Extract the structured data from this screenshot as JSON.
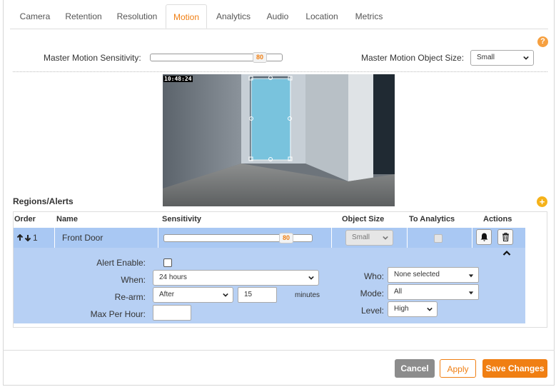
{
  "tabs": [
    "Camera",
    "Retention",
    "Resolution",
    "Motion",
    "Analytics",
    "Audio",
    "Location",
    "Metrics"
  ],
  "active_tab": "Motion",
  "help_icon": "?",
  "master": {
    "sensitivity_label": "Master Motion Sensitivity:",
    "sensitivity_value": "80",
    "object_size_label": "Master Motion Object Size:",
    "object_size_value": "Small"
  },
  "camera": {
    "timestamp": "10:48:24"
  },
  "regions": {
    "title": "Regions/Alerts",
    "add_icon": "+",
    "columns": {
      "order": "Order",
      "name": "Name",
      "sensitivity": "Sensitivity",
      "object_size": "Object Size",
      "to_analytics": "To Analytics",
      "actions": "Actions"
    },
    "row": {
      "order": "1",
      "name": "Front Door",
      "sensitivity": "80",
      "object_size": "Small"
    },
    "alert": {
      "enable_label": "Alert Enable:",
      "when_label": "When:",
      "when_value": "24 hours",
      "rearm_label": "Re-arm:",
      "rearm_value": "After",
      "rearm_number": "15",
      "rearm_unit": "minutes",
      "max_label": "Max Per Hour:",
      "max_value": "",
      "who_label": "Who:",
      "who_value": "None selected",
      "mode_label": "Mode:",
      "mode_value": "All",
      "level_label": "Level:",
      "level_value": "High"
    }
  },
  "buttons": {
    "cancel": "Cancel",
    "apply": "Apply",
    "save": "Save Changes"
  },
  "colors": {
    "accent": "#f07f13",
    "row": "#a9c8f3",
    "detail": "#b7d0f4"
  }
}
